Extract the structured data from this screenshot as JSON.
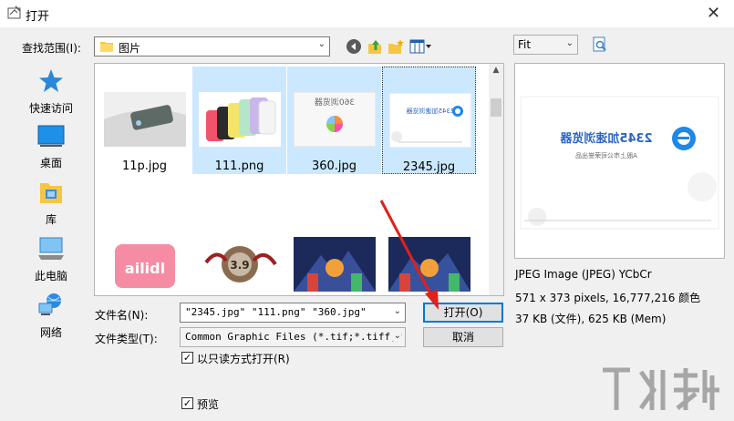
{
  "window": {
    "title": "打开",
    "close": "✕"
  },
  "lookin": {
    "label": "查找范围(I):",
    "value": "图片"
  },
  "sidebar": {
    "items": [
      {
        "label": "快速访问"
      },
      {
        "label": "桌面"
      },
      {
        "label": "库"
      },
      {
        "label": "此电脑"
      },
      {
        "label": "网络"
      }
    ]
  },
  "files": [
    {
      "name": "11p.jpg",
      "selected": false
    },
    {
      "name": "111.png",
      "selected": true
    },
    {
      "name": "360.jpg",
      "selected": true
    },
    {
      "name": "2345.jpg",
      "selected": true
    },
    {
      "name": "",
      "selected": false
    },
    {
      "name": "",
      "selected": false
    },
    {
      "name": "",
      "selected": false
    },
    {
      "name": "",
      "selected": false
    }
  ],
  "thumb_text": {
    "t360": "360浏览器",
    "t2345": "2345加速浏览器",
    "r1": "ailidl",
    "r2": "3.9"
  },
  "form": {
    "filename_label": "文件名(N):",
    "filename_value": "\"2345.jpg\" \"111.png\" \"360.jpg\"",
    "filetype_label": "文件类型(T):",
    "filetype_value": "Common Graphic Files (*.tif;*.tiff;*.",
    "open_label": "打开(O)",
    "cancel_label": "取消",
    "readonly_label": "以只读方式打开(R)",
    "preview_label": "预览",
    "checkmark": "✓"
  },
  "preview": {
    "fit_value": "Fit",
    "info1": "JPEG Image (JPEG) YCbCr",
    "info2": "571 x 373 pixels, 16,777,216 颜色",
    "info3": "37 KB (文件), 625 KB (Mem)",
    "image_text": "2345加速浏览器",
    "image_subtext": "A股上市公司荣誉出品"
  },
  "colors": {
    "accent": "#0078d7",
    "selection": "#cce8ff",
    "arrow": "#e0201b"
  }
}
